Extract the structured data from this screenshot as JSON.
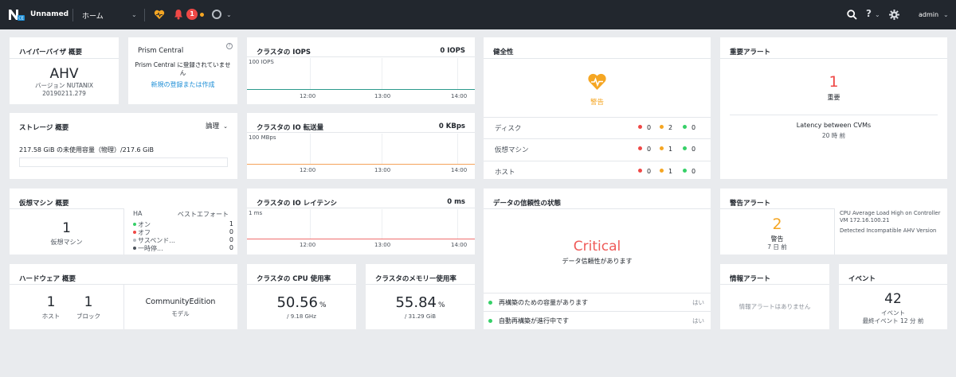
{
  "topbar": {
    "cluster_name": "Unnamed",
    "home_label": "ホーム",
    "alert_count": "1",
    "user": "admin",
    "help_label": "?"
  },
  "hypervisor": {
    "title": "ハイパーバイザ 概要",
    "name": "AHV",
    "version_label": "バージョン NUTANIX",
    "version": "20190211.279"
  },
  "prism_central": {
    "title": "Prism Central",
    "message": "Prism Central に登録されていません",
    "link": "新規の登録または作成",
    "info_icon": "?"
  },
  "iops": {
    "title": "クラスタの IOPS",
    "value": "0 IOPS",
    "ymax_label": "100 IOPS",
    "ticks": [
      "12:00",
      "13:00",
      "14:00"
    ],
    "line_color": "#2b9a8c"
  },
  "health": {
    "title": "健全性",
    "status": "警告",
    "rows": [
      {
        "label": "ディスク",
        "red": "0",
        "orange": "2",
        "green": "0"
      },
      {
        "label": "仮想マシン",
        "red": "0",
        "orange": "1",
        "green": "0"
      },
      {
        "label": "ホスト",
        "red": "0",
        "orange": "1",
        "green": "0"
      }
    ]
  },
  "critical_alerts": {
    "title": "重要アラート",
    "count": "1",
    "count_label": "重要",
    "item_title": "Latency between CVMs",
    "item_time": "20 時 前"
  },
  "storage": {
    "title": "ストレージ 概要",
    "mode": "論理",
    "capacity_text": "217.58 GiB の未使用容量（物理）/217.6 GiB"
  },
  "io_bandwidth": {
    "title": "クラスタの IO 転送量",
    "value": "0 KBps",
    "ymax_label": "100 MBps",
    "ticks": [
      "12:00",
      "13:00",
      "14:00"
    ],
    "line_color": "#f5a35b"
  },
  "vm_summary": {
    "title": "仮想マシン 概要",
    "count": "1",
    "count_label": "仮想マシン",
    "ha_label": "HA",
    "best_effort_label": "ベストエフォート",
    "states": [
      {
        "label": "オン",
        "value": "1",
        "color": "#36d068"
      },
      {
        "label": "オフ",
        "value": "0",
        "color": "#ef4846"
      },
      {
        "label": "サスペンド...",
        "value": "0",
        "color": "#b7bdc4"
      },
      {
        "label": "一時停...",
        "value": "0",
        "color": "#4b525b"
      }
    ]
  },
  "latency": {
    "title": "クラスタの IO レイテンシ",
    "value": "0 ms",
    "ymax_label": "1 ms",
    "ticks": [
      "12:00",
      "13:00",
      "14:00"
    ],
    "line_color": "#ef6e6e"
  },
  "data_resiliency": {
    "title": "データの信頼性の状態",
    "status": "Critical",
    "status_sub": "データ信頼性があります",
    "rows": [
      {
        "label": "再構築のための容量があります",
        "value": "はい"
      },
      {
        "label": "自動再構築が進行中です",
        "value": "はい"
      }
    ]
  },
  "warning_alerts": {
    "title": "警告アラート",
    "count": "2",
    "count_label": "警告",
    "time": "7 日 前",
    "items": [
      "CPU Average Load High on Controller VM 172.16.100.21",
      "Detected Incompatible AHV Version"
    ]
  },
  "hardware": {
    "title": "ハードウェア 概要",
    "hosts": "1",
    "hosts_label": "ホスト",
    "blocks": "1",
    "blocks_label": "ブロック",
    "model": "CommunityEdition",
    "model_label": "モデル"
  },
  "cpu": {
    "title": "クラスタの CPU 使用率",
    "value": "50.56",
    "unit": "%",
    "sub": "/ 9.18 GHz"
  },
  "memory": {
    "title": "クラスタのメモリー使用率",
    "value": "55.84",
    "unit": "%",
    "sub": "/ 31.29 GiB"
  },
  "info_alerts": {
    "title": "情報アラート",
    "message": "情報アラートはありません"
  },
  "events": {
    "title": "イベント",
    "count": "42",
    "count_label": "イベント",
    "last": "最終イベント 12 分 前"
  },
  "colors": {
    "topbar": "#22272e",
    "critical": "#ef4846",
    "warning": "#f5a623",
    "ok": "#36d068",
    "link": "#1b8dd6"
  }
}
